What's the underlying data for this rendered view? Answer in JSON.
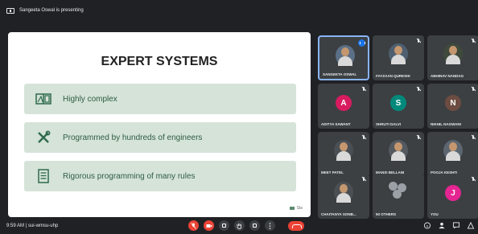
{
  "topbar": {
    "presenting_text": "Sangeeta Oswal is presenting"
  },
  "slide": {
    "title": "EXPERT SYSTEMS",
    "rows": [
      {
        "icon": "complex-diagram-icon",
        "text": "Highly complex"
      },
      {
        "icon": "tools-icon",
        "text": "Programmed by hundreds of engineers"
      },
      {
        "icon": "document-rules-icon",
        "text": "Rigorous programming of many rules"
      }
    ],
    "footer": "Sts"
  },
  "participants": [
    {
      "name": "Sangeeta Oswal",
      "type": "photo",
      "photo_bg": "#5b6f86",
      "speaking": true,
      "muted": false
    },
    {
      "name": "FAYZAAN QURESHI",
      "type": "photo",
      "photo_bg": "#4d5f70",
      "speaking": false,
      "muted": true
    },
    {
      "name": "ABHINAV NANDAG",
      "type": "photo",
      "photo_bg": "#3f4a3c",
      "speaking": false,
      "muted": true
    },
    {
      "name": "ADITYA SAWANT",
      "type": "initial",
      "initial": "A",
      "color": "#d81b60",
      "muted": true
    },
    {
      "name": "SHRUTI DALVI",
      "type": "initial",
      "initial": "S",
      "color": "#00897b",
      "muted": true
    },
    {
      "name": "NIKHIL NAGWANI",
      "type": "initial",
      "initial": "N",
      "color": "#6d4c41",
      "muted": true
    },
    {
      "name": "Meet Patel",
      "type": "photo",
      "photo_bg": "#4a4f55",
      "muted": true
    },
    {
      "name": "MANSI BELLANI",
      "type": "photo",
      "photo_bg": "#545a60",
      "muted": true
    },
    {
      "name": "pooja keshti",
      "type": "photo",
      "photo_bg": "#5c6670",
      "muted": true
    },
    {
      "name": "CHAITANYA SONB...",
      "type": "photo",
      "photo_bg": "#4b4f54",
      "muted": true
    },
    {
      "name": "50 others",
      "type": "others",
      "muted": false
    },
    {
      "name": "You",
      "type": "initial",
      "initial": "J",
      "color": "#e52592",
      "muted": true
    }
  ],
  "bottombar": {
    "time_meeting": "9:59 AM | sui-wmsu-uhp"
  },
  "colors": {
    "background": "#202124",
    "tile": "#3c4043",
    "slide_row": "#d5e3d8",
    "slide_text": "#2f5d44",
    "accent_red": "#ea4335",
    "speaking_blue": "#1a73e8"
  }
}
